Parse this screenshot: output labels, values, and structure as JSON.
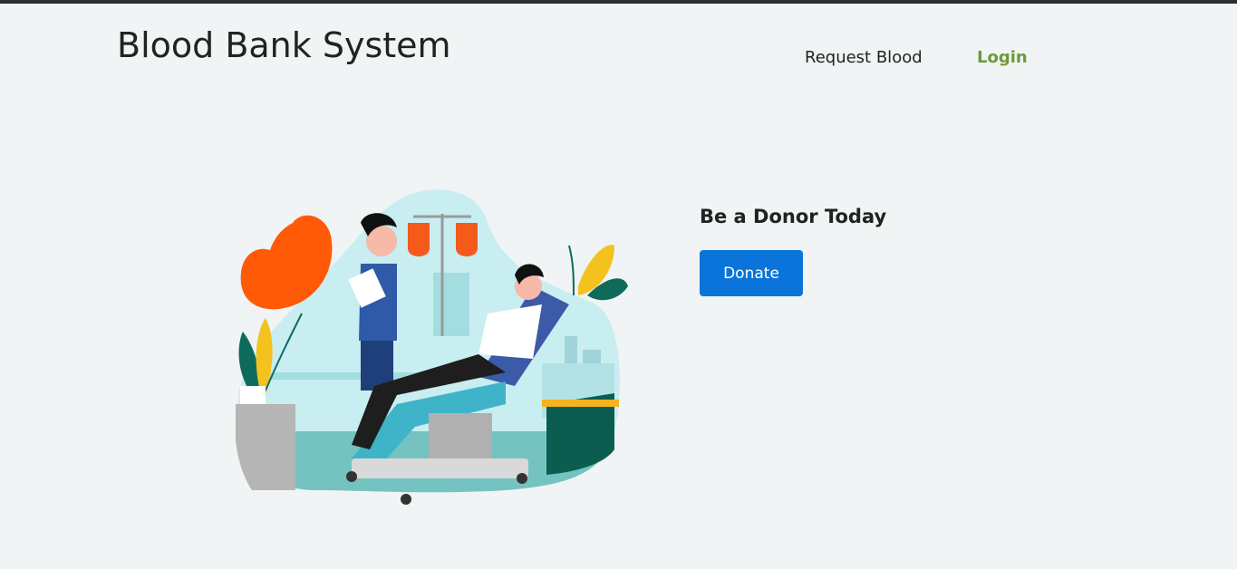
{
  "header": {
    "brand": "Blood Bank System",
    "nav": {
      "request_blood": "Request Blood",
      "login": "Login"
    }
  },
  "hero": {
    "title": "Be a Donor Today",
    "donate_label": "Donate",
    "illustration": "blood-donation-illustration"
  },
  "colors": {
    "background": "#f0f4f5",
    "primary": "#0a74da",
    "login_link": "#6e9b3a",
    "heart": "#ff5a08"
  }
}
